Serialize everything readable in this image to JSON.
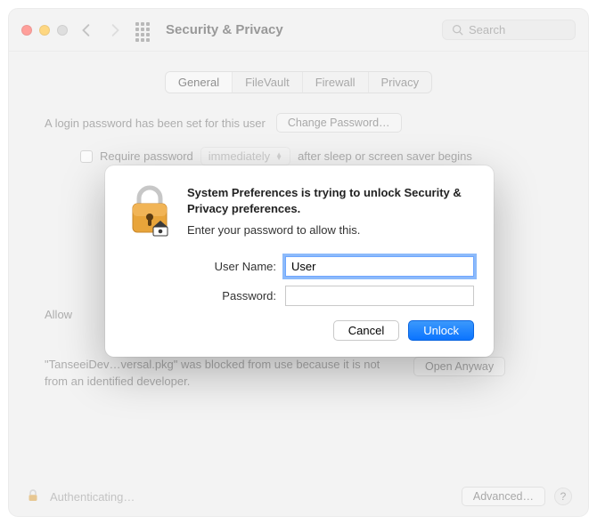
{
  "window": {
    "title": "Security & Privacy",
    "search_placeholder": "Search"
  },
  "tabs": [
    {
      "label": "General",
      "active": true
    },
    {
      "label": "FileVault",
      "active": false
    },
    {
      "label": "Firewall",
      "active": false
    },
    {
      "label": "Privacy",
      "active": false
    }
  ],
  "login_row": {
    "text": "A login password has been set for this user",
    "button": "Change Password…"
  },
  "require_row": {
    "checkbox_label": "Require password",
    "select_value": "immediately",
    "suffix": "after sleep or screen saver begins"
  },
  "allow_label_prefix": "Allow",
  "blocked": {
    "message": "\"TanseeiDev…versal.pkg\" was blocked from use because it is not from an identified developer.",
    "button": "Open Anyway"
  },
  "footer": {
    "status": "Authenticating…",
    "advanced": "Advanced…",
    "help": "?"
  },
  "modal": {
    "title": "System Preferences is trying to unlock Security & Privacy preferences.",
    "subtitle": "Enter your password to allow this.",
    "username_label": "User Name:",
    "username_value": "User",
    "password_label": "Password:",
    "password_value": "",
    "cancel": "Cancel",
    "unlock": "Unlock"
  }
}
